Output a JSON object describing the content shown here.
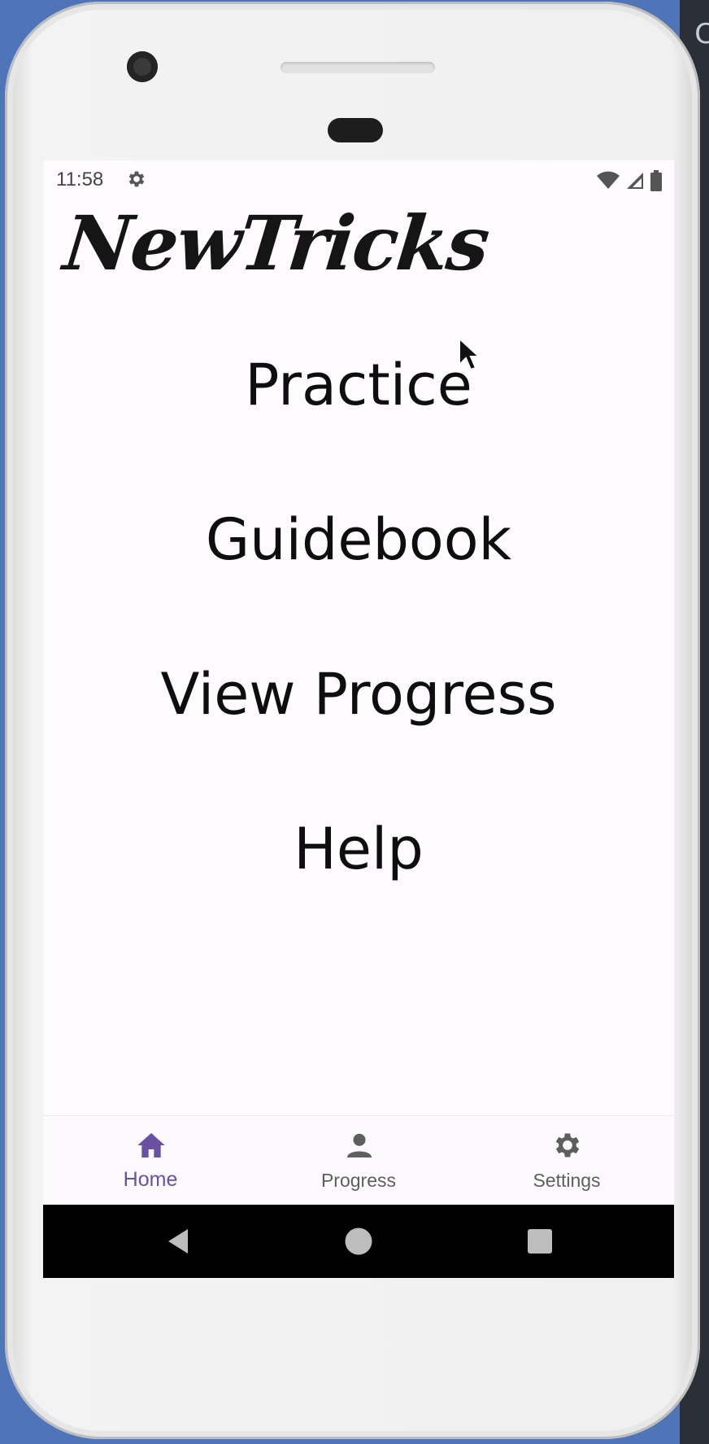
{
  "background": {
    "corner_text": "C"
  },
  "status_bar": {
    "time": "11:58"
  },
  "app": {
    "title": "NewTricks"
  },
  "menu": {
    "practice": "Practice",
    "guidebook": "Guidebook",
    "view_progress": "View Progress",
    "help": "Help"
  },
  "bottom_nav": {
    "items": [
      {
        "label": "Home",
        "icon": "home-icon",
        "active": true
      },
      {
        "label": "Progress",
        "icon": "person-icon",
        "active": false
      },
      {
        "label": "Settings",
        "icon": "gear-icon",
        "active": false
      }
    ]
  },
  "colors": {
    "accent": "#6a4fa3",
    "screen_bg": "#fdfbfe",
    "nav_inactive": "#5e5e5e",
    "text": "#0e0e0e"
  }
}
